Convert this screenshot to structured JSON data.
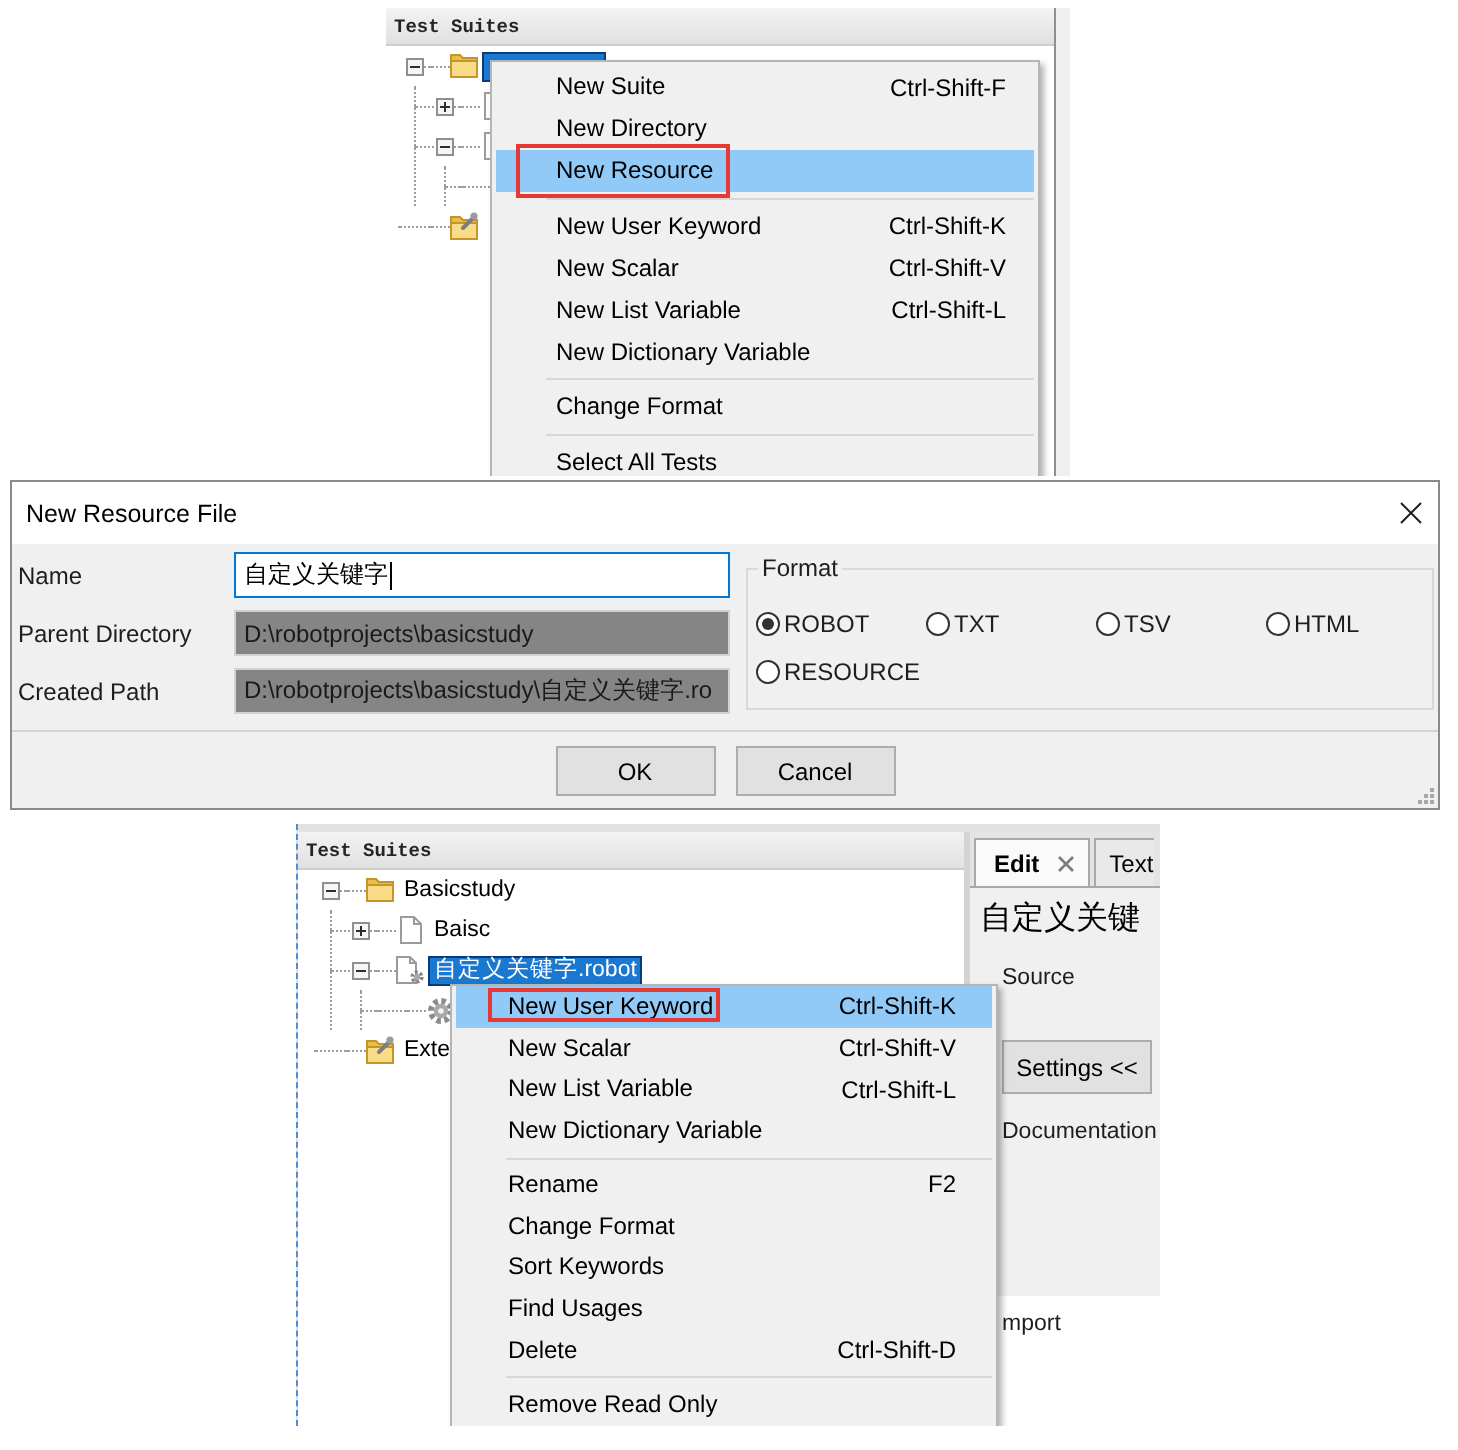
{
  "top_view": {
    "tree": {
      "header": "Test Suites",
      "nodes": [
        {
          "kind": "folder",
          "expanded": true,
          "selected": true,
          "children": [
            {
              "kind": "file",
              "expanded": false,
              "selected": false
            },
            {
              "kind": "file",
              "expanded": true,
              "selected": false,
              "children": [
                {
                  "selected": false
                }
              ]
            }
          ]
        },
        {
          "kind": "external",
          "selected": false
        }
      ]
    },
    "context_menu": {
      "items": [
        {
          "kind": "item",
          "label": "New Suite",
          "shortcut": "Ctrl-Shift-F",
          "selected": false,
          "callout": false
        },
        {
          "kind": "item",
          "label": "New Directory",
          "selected": false,
          "callout": false
        },
        {
          "kind": "item",
          "label": "New Resource",
          "selected": true,
          "callout": true
        },
        {
          "kind": "separator"
        },
        {
          "kind": "item",
          "label": "New User Keyword",
          "shortcut": "Ctrl-Shift-K",
          "selected": false,
          "callout": false
        },
        {
          "kind": "item",
          "label": "New Scalar",
          "shortcut": "Ctrl-Shift-V",
          "selected": false,
          "callout": false
        },
        {
          "kind": "item",
          "label": "New List Variable",
          "shortcut": "Ctrl-Shift-L",
          "selected": false,
          "callout": false
        },
        {
          "kind": "item",
          "label": "New Dictionary Variable",
          "selected": false,
          "callout": false
        },
        {
          "kind": "separator"
        },
        {
          "kind": "item",
          "label": "Change Format",
          "selected": false,
          "callout": false
        },
        {
          "kind": "separator"
        },
        {
          "kind": "item",
          "label": "Select All Tests",
          "selected": false,
          "callout": false
        }
      ]
    }
  },
  "dialog": {
    "title": "New Resource File",
    "fields": [
      {
        "label": "Name",
        "value": "自定义关键字",
        "focused": true,
        "disabled": false
      },
      {
        "label": "Parent Directory",
        "value": "D:\\robotprojects\\basicstudy",
        "focused": false,
        "disabled": true
      },
      {
        "label": "Created Path",
        "value": "D:\\robotprojects\\basicstudy\\自定义关键字.ro",
        "focused": false,
        "disabled": true
      }
    ],
    "format": {
      "legend": "Format",
      "options": [
        {
          "label": "ROBOT",
          "selected": true
        },
        {
          "label": "TXT",
          "selected": false
        },
        {
          "label": "TSV",
          "selected": false
        },
        {
          "label": "HTML",
          "selected": false
        },
        {
          "label": "RESOURCE",
          "selected": false
        }
      ]
    },
    "buttons": [
      "OK",
      "Cancel"
    ]
  },
  "bottom_view": {
    "tree": {
      "header": "Test Suites",
      "nodes": [
        {
          "kind": "folder",
          "label": "Basicstudy",
          "expanded": true,
          "selected": false,
          "children": [
            {
              "kind": "file",
              "label": "Baisc",
              "expanded": false,
              "selected": false
            },
            {
              "kind": "resource",
              "label": "自定义关键字.robot",
              "expanded": true,
              "selected": true,
              "children": [
                {
                  "kind": "keyword",
                  "selected": false
                }
              ]
            }
          ]
        },
        {
          "kind": "external",
          "label": "Exte",
          "selected": false
        }
      ]
    },
    "context_menu": {
      "items": [
        {
          "kind": "item",
          "label": "New User Keyword",
          "shortcut": "Ctrl-Shift-K",
          "selected": true,
          "callout": true
        },
        {
          "kind": "item",
          "label": "New Scalar",
          "shortcut": "Ctrl-Shift-V",
          "selected": false,
          "callout": false
        },
        {
          "kind": "item",
          "label": "New List Variable",
          "shortcut": "Ctrl-Shift-L",
          "selected": false,
          "callout": false
        },
        {
          "kind": "item",
          "label": "New Dictionary Variable",
          "selected": false,
          "callout": false
        },
        {
          "kind": "separator"
        },
        {
          "kind": "item",
          "label": "Rename",
          "shortcut": "F2",
          "selected": false,
          "callout": false
        },
        {
          "kind": "item",
          "label": "Change Format",
          "selected": false,
          "callout": false
        },
        {
          "kind": "item",
          "label": "Sort Keywords",
          "selected": false,
          "callout": false
        },
        {
          "kind": "item",
          "label": "Find Usages",
          "selected": false,
          "callout": false
        },
        {
          "kind": "item",
          "label": "Delete",
          "shortcut": "Ctrl-Shift-D",
          "selected": false,
          "callout": false
        },
        {
          "kind": "separator"
        },
        {
          "kind": "item",
          "label": "Remove Read Only",
          "selected": false,
          "callout": false
        }
      ]
    },
    "editor": {
      "tabs": [
        {
          "label": "Edit",
          "selected": true,
          "closable": true
        },
        {
          "label": "Text",
          "selected": false
        }
      ],
      "title": "自定义关键",
      "source_label": "Source",
      "settings_button": "Settings <<",
      "documentation_label": "Documentation",
      "import_label": "mport"
    }
  }
}
